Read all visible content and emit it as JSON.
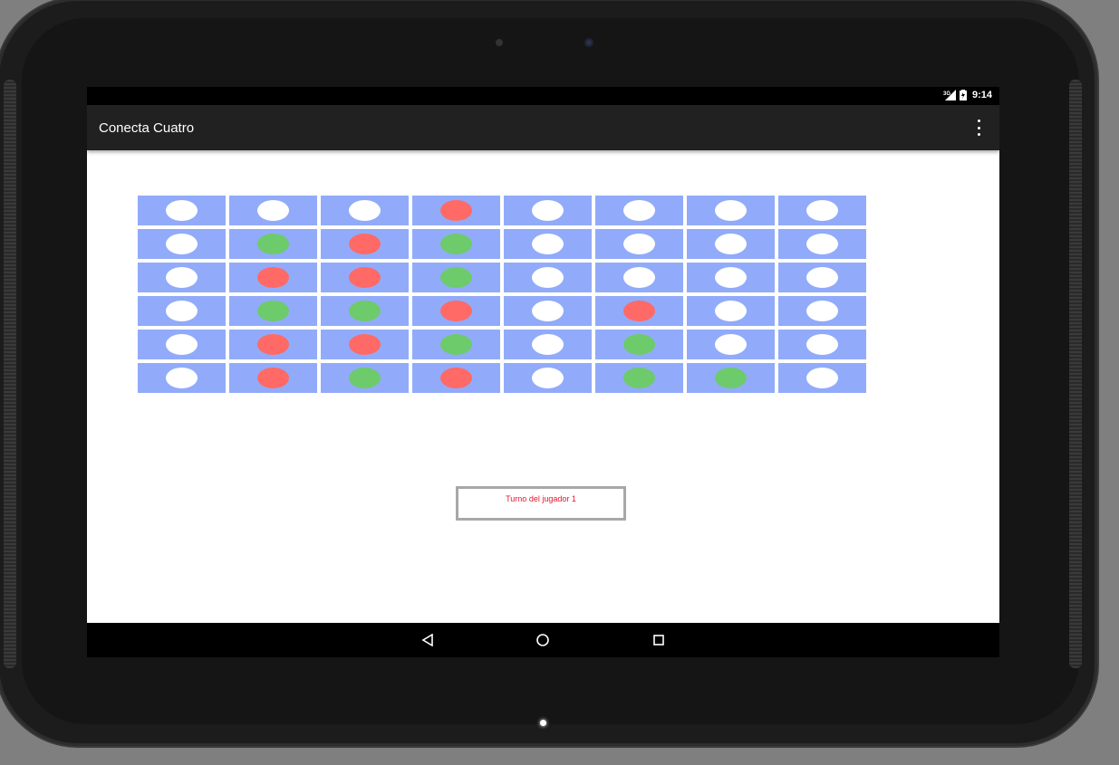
{
  "status_bar": {
    "network": "3G",
    "time": "9:14"
  },
  "app_bar": {
    "title": "Conecta Cuatro",
    "overflow_icon": "more-vert-icon"
  },
  "board": {
    "columns": 8,
    "rows": [
      [
        "empty",
        "empty",
        "empty",
        "red",
        "empty",
        "empty",
        "empty",
        "empty"
      ],
      [
        "empty",
        "green",
        "red",
        "green",
        "empty",
        "empty",
        "empty",
        "empty"
      ],
      [
        "empty",
        "red",
        "red",
        "green",
        "empty",
        "empty",
        "empty",
        "empty"
      ],
      [
        "empty",
        "green",
        "green",
        "red",
        "empty",
        "red",
        "empty",
        "empty"
      ],
      [
        "empty",
        "red",
        "red",
        "green",
        "empty",
        "green",
        "empty",
        "empty"
      ],
      [
        "empty",
        "red",
        "green",
        "red",
        "empty",
        "green",
        "green",
        "empty"
      ]
    ],
    "colors": {
      "cell": "#91abfa",
      "empty": "#ffffff",
      "red": "#ff6a66",
      "green": "#6dcb6b"
    }
  },
  "status": {
    "turn_text": "Turno del jugador 1",
    "color": "#e8122b"
  },
  "nav_bar": {
    "back_icon": "back-triangle-icon",
    "home_icon": "home-circle-icon",
    "recents_icon": "recents-square-icon"
  }
}
